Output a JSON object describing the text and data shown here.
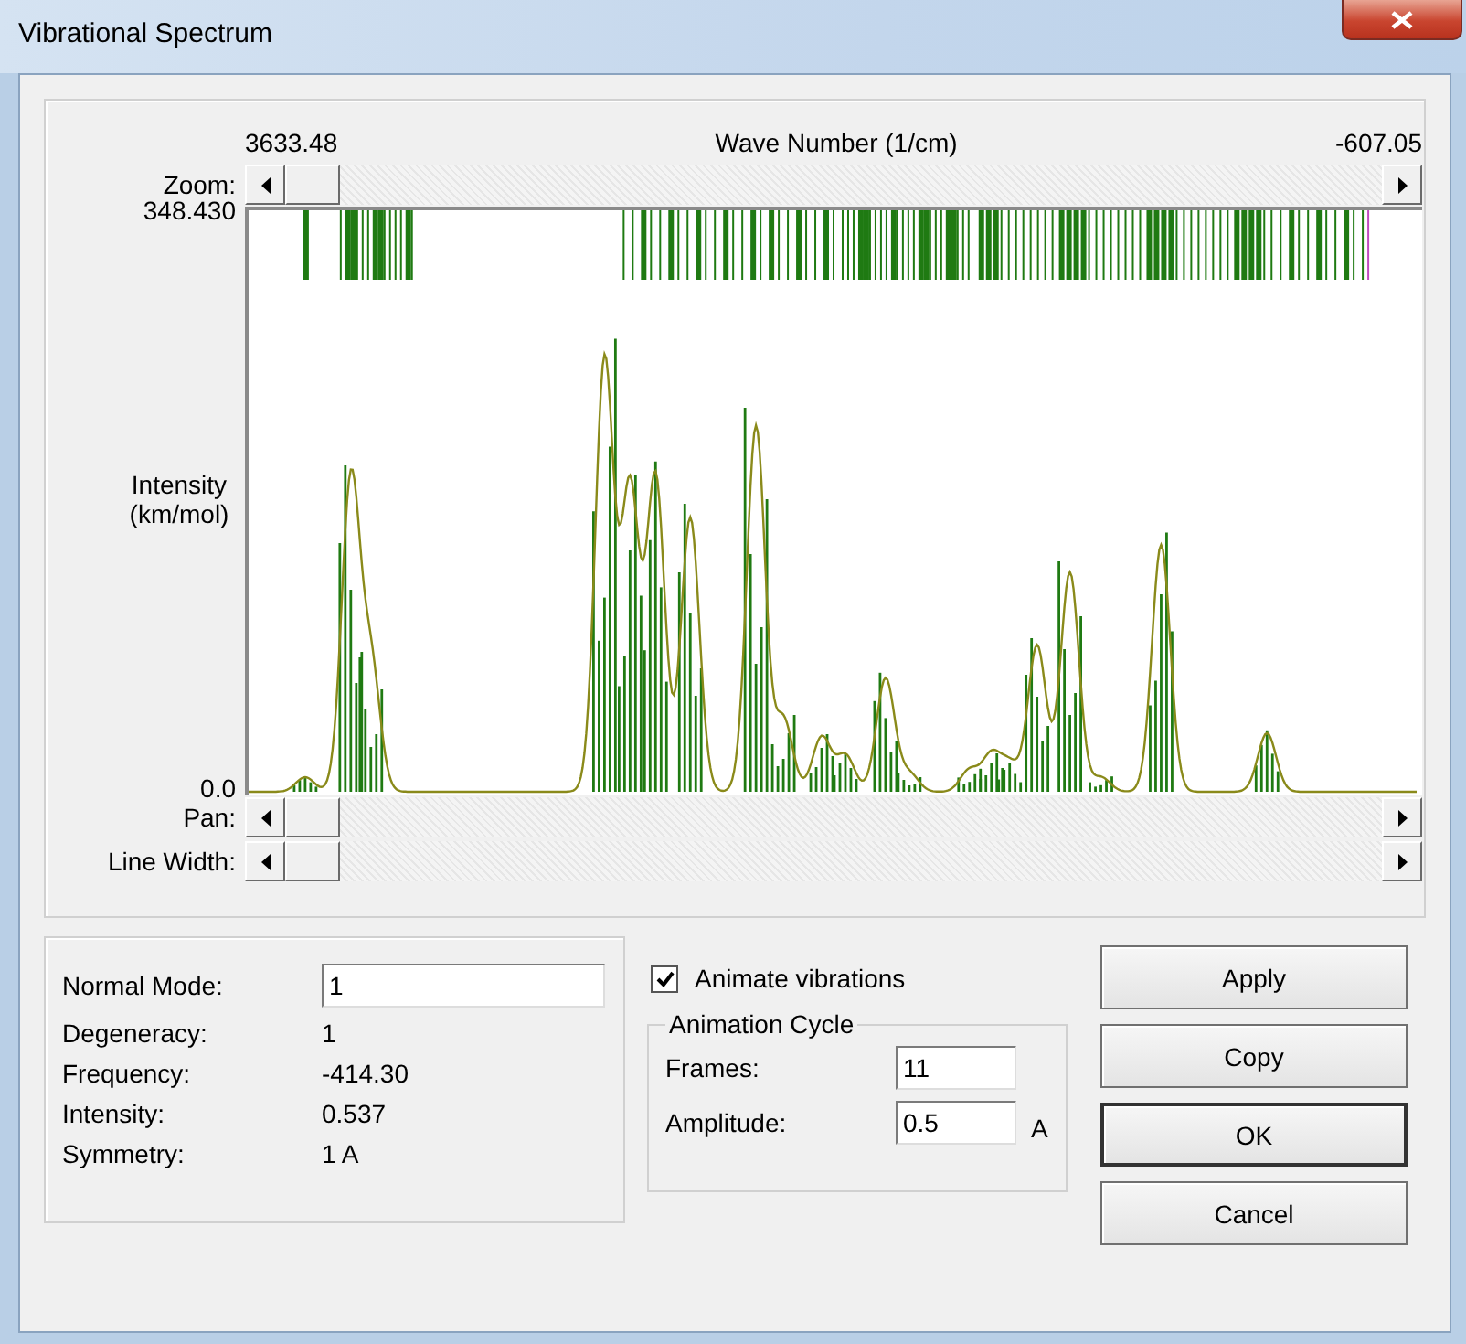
{
  "window": {
    "title": "Vibrational Spectrum"
  },
  "axis": {
    "x_start": "3633.48",
    "x_label": "Wave Number (1/cm)",
    "x_end": "-607.05",
    "y_max": "348.430",
    "y_label": "Intensity (km/mol)",
    "y_min": "0.0"
  },
  "zoom_scrollbar": {
    "label": "Zoom:"
  },
  "scrollbars": [
    {
      "label": "Pan:"
    },
    {
      "label": "Line Width:"
    }
  ],
  "mode_info": {
    "field": {
      "label": "Normal Mode:",
      "value": "1"
    },
    "rows": [
      {
        "label": "Degeneracy:",
        "value": "1"
      },
      {
        "label": "Frequency:",
        "value": "-414.30"
      },
      {
        "label": "Intensity:",
        "value": "0.537"
      },
      {
        "label": "Symmetry:",
        "value": "1 A"
      }
    ]
  },
  "animate": {
    "label": "Animate vibrations",
    "checked": true
  },
  "animation_cycle": {
    "title": "Animation Cycle",
    "fields": [
      {
        "label": "Frames:",
        "value": "11"
      },
      {
        "label": "Amplitude:",
        "value": "0.5",
        "unit": "A"
      }
    ]
  },
  "buttons": [
    {
      "label": "Apply",
      "default": false
    },
    {
      "label": "Copy",
      "default": false
    },
    {
      "label": "OK",
      "default": true
    },
    {
      "label": "Cancel",
      "default": false
    }
  ]
}
